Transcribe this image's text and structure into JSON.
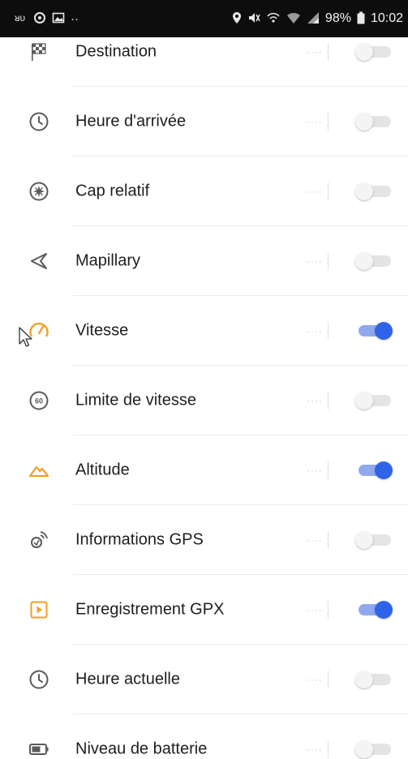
{
  "status_bar": {
    "left_icons": [
      "ru-icon",
      "circle-icon",
      "image-icon",
      "more-dots-icon"
    ],
    "right_icons": [
      "location-pin-icon",
      "mute-icon",
      "hotspot-icon",
      "wifi-icon",
      "signal-icon"
    ],
    "battery_text": "98%",
    "time": "10:02"
  },
  "colors": {
    "accent": "#2f64e8",
    "icon_orange": "#f0a020",
    "icon_gray": "#5a5a5a"
  },
  "widgets": [
    {
      "label": "Destination",
      "icon": "checkered-flag-icon",
      "enabled": false
    },
    {
      "label": "Heure d'arrivée",
      "icon": "clock-icon",
      "enabled": false
    },
    {
      "label": "Cap relatif",
      "icon": "compass-icon",
      "enabled": false
    },
    {
      "label": "Mapillary",
      "icon": "mapillary-icon",
      "enabled": false
    },
    {
      "label": "Vitesse",
      "icon": "speedometer-icon",
      "enabled": true
    },
    {
      "label": "Limite de vitesse",
      "icon": "speed-limit-icon",
      "enabled": false
    },
    {
      "label": "Altitude",
      "icon": "altitude-icon",
      "enabled": true
    },
    {
      "label": "Informations GPS",
      "icon": "gps-signal-icon",
      "enabled": false
    },
    {
      "label": "Enregistrement GPX",
      "icon": "gpx-record-icon",
      "enabled": true
    },
    {
      "label": "Heure actuelle",
      "icon": "clock-icon",
      "enabled": false
    },
    {
      "label": "Niveau de batterie",
      "icon": "battery-icon",
      "enabled": false
    }
  ],
  "speed_limit_icon_text": "60"
}
